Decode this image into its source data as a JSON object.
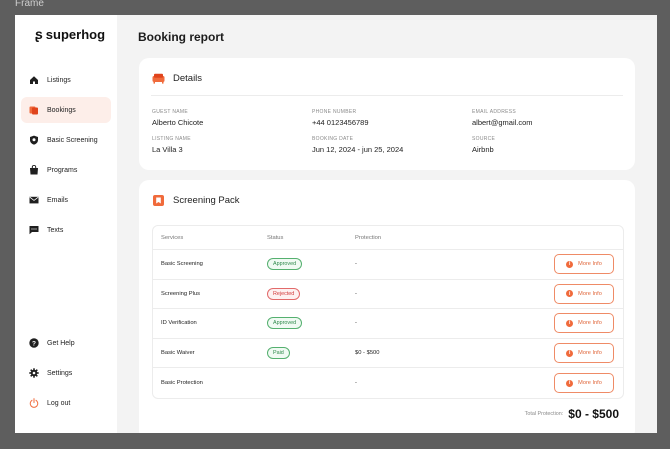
{
  "frame": {
    "label": "Frame"
  },
  "brand": {
    "name": "superhog"
  },
  "nav": {
    "items": [
      {
        "label": "Listings",
        "icon": "home-icon"
      },
      {
        "label": "Bookings",
        "icon": "bookings-icon",
        "active": true
      },
      {
        "label": "Basic Screening",
        "icon": "shield-icon"
      },
      {
        "label": "Programs",
        "icon": "bag-icon"
      },
      {
        "label": "Emails",
        "icon": "mail-icon"
      },
      {
        "label": "Texts",
        "icon": "chat-icon"
      }
    ],
    "bottom": [
      {
        "label": "Get Help",
        "icon": "help-icon"
      },
      {
        "label": "Settings",
        "icon": "gear-icon"
      },
      {
        "label": "Log out",
        "icon": "power-icon"
      }
    ]
  },
  "page": {
    "title": "Booking report"
  },
  "details": {
    "title": "Details",
    "fields": {
      "guest_name": {
        "label": "GUEST NAME",
        "value": "Alberto Chicote"
      },
      "phone": {
        "label": "PHONE NUMBER",
        "value": "+44 0123456789"
      },
      "email": {
        "label": "EMAIL ADDRESS",
        "value": "albert@gmail.com"
      },
      "listing": {
        "label": "LISTING NAME",
        "value": "La Villa 3"
      },
      "booking_date": {
        "label": "BOOKING DATE",
        "value": "Jun 12, 2024 - jun 25, 2024"
      },
      "source": {
        "label": "SOURCE",
        "value": "Airbnb"
      }
    }
  },
  "screening": {
    "title": "Screening Pack",
    "columns": {
      "services": "Services",
      "status": "Status",
      "protection": "Protection"
    },
    "rows": [
      {
        "service": "Basic Screening",
        "status": "Approved",
        "protection": "-",
        "action": "More Info"
      },
      {
        "service": "Screening Plus",
        "status": "Rejected",
        "protection": "-",
        "action": "More Info"
      },
      {
        "service": "ID Verification",
        "status": "Approved",
        "protection": "-",
        "action": "More Info"
      },
      {
        "service": "Basic Waiver",
        "status": "Paid",
        "protection": "$0 - $500",
        "action": "More Info"
      },
      {
        "service": "Basic Protection",
        "status": "",
        "protection": "-",
        "action": "More Info"
      }
    ],
    "total": {
      "label": "Total Protection:",
      "value": "$0 - $500"
    }
  },
  "colors": {
    "accent": "#f06a3b",
    "approved": "#2f8a4c",
    "rejected": "#d23a3a",
    "background": "#f3f3f3"
  }
}
